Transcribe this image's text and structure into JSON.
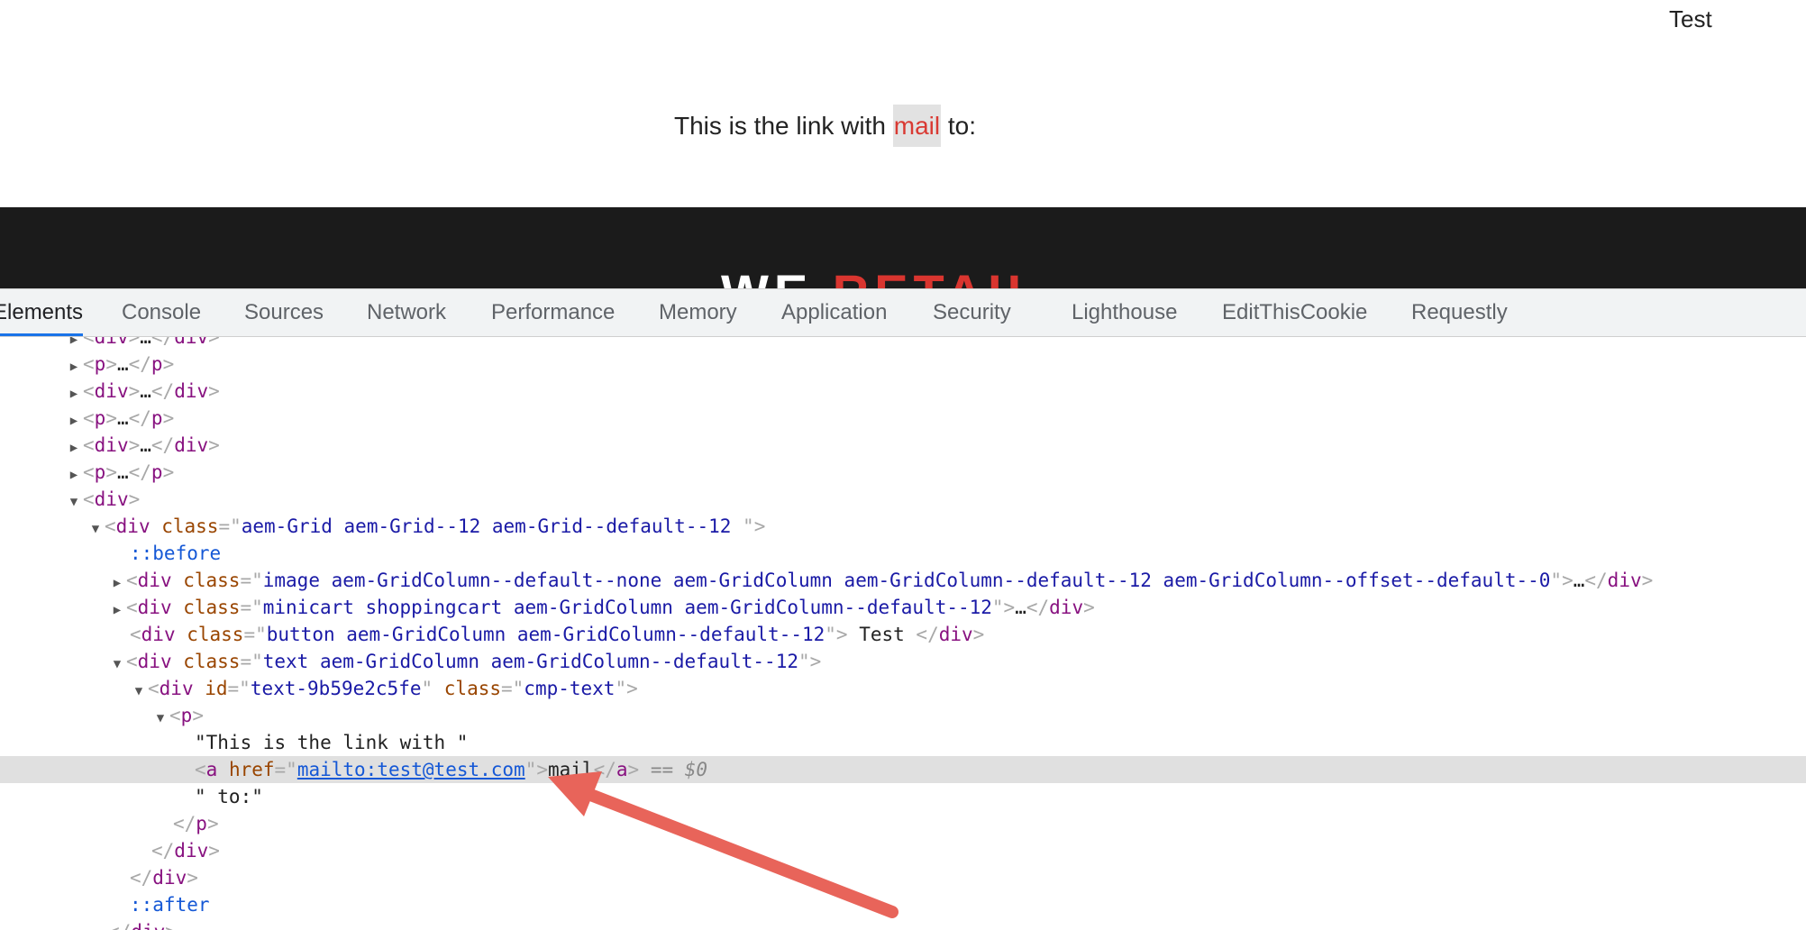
{
  "page": {
    "top_button_text": "Test",
    "paragraph_before": "This is the link with ",
    "paragraph_link": "mail",
    "paragraph_after": " to:",
    "footer_part1": "WE ",
    "footer_part2": "RETAIL"
  },
  "devtools": {
    "tabs": [
      "Elements",
      "Console",
      "Sources",
      "Network",
      "Performance",
      "Memory",
      "Application",
      "Security",
      "Lighthouse",
      "EditThisCookie",
      "Requestly"
    ],
    "active_tab": "Elements",
    "tree": {
      "r0": {
        "a": "div",
        "b": ">",
        "c": "…",
        "d": "</",
        "e": "div",
        "f": ">"
      },
      "r1": {
        "a": "<",
        "b": "p",
        "c": ">",
        "d": "…",
        "e": "</",
        "f": "p",
        "g": ">"
      },
      "r2": {
        "a": "<",
        "b": "div",
        "c": ">",
        "d": "…",
        "e": "</",
        "f": "div",
        "g": ">"
      },
      "r3": {
        "a": "<",
        "b": "p",
        "c": ">",
        "d": "…",
        "e": "</",
        "f": "p",
        "g": ">"
      },
      "r4": {
        "a": "<",
        "b": "div",
        "c": ">",
        "d": "…",
        "e": "</",
        "f": "div",
        "g": ">"
      },
      "r5": {
        "a": "<",
        "b": "p",
        "c": ">",
        "d": "…",
        "e": "</",
        "f": "p",
        "g": ">"
      },
      "r6": {
        "a": "<",
        "b": "div",
        "c": ">"
      },
      "r7": {
        "a": "<",
        "b": "div",
        "c": " class",
        "d": "=\"",
        "e": "aem-Grid aem-Grid--12 aem-Grid--default--12 ",
        "f": "\">"
      },
      "r8": {
        "a": "::before"
      },
      "r9": {
        "a": "<",
        "b": "div",
        "c": " class",
        "d": "=\"",
        "e": "image aem-GridColumn--default--none aem-GridColumn aem-GridColumn--default--12 aem-GridColumn--offset--default--0",
        "f": "\">",
        "g": "…",
        "h": "</",
        "i": "div",
        "j": ">"
      },
      "r10": {
        "a": "<",
        "b": "div",
        "c": " class",
        "d": "=\"",
        "e": "minicart shoppingcart aem-GridColumn aem-GridColumn--default--12",
        "f": "\">",
        "g": "…",
        "h": "</",
        "i": "div",
        "j": ">"
      },
      "r11": {
        "a": "<",
        "b": "div",
        "c": " class",
        "d": "=\"",
        "e": "button aem-GridColumn aem-GridColumn--default--12",
        "f": "\">",
        "g": " Test ",
        "h": "</",
        "i": "div",
        "j": ">"
      },
      "r12": {
        "a": "<",
        "b": "div",
        "c": " class",
        "d": "=\"",
        "e": "text aem-GridColumn aem-GridColumn--default--12",
        "f": "\">"
      },
      "r13": {
        "a": "<",
        "b": "div",
        "c": " id",
        "d": "=\"",
        "e": "text-9b59e2c5fe",
        "f": "\"",
        "g": " class",
        "h": "=\"",
        "i": "cmp-text",
        "j": "\">"
      },
      "r14": {
        "a": "<",
        "b": "p",
        "c": ">"
      },
      "r15": {
        "a": "\"This is the link with \""
      },
      "r16": {
        "a": "<",
        "b": "a",
        "c": " href",
        "d": "=\"",
        "e": "mailto:test@test.com",
        "f": "\">",
        "g": "mail",
        "h": "</",
        "i": "a",
        "j": ">",
        "k": " == ",
        "l": "$0"
      },
      "r17": {
        "a": "\" to:\""
      },
      "r18": {
        "a": "</",
        "b": "p",
        "c": ">"
      },
      "r19": {
        "a": "</",
        "b": "div",
        "c": ">"
      },
      "r20": {
        "a": "</",
        "b": "div",
        "c": ">"
      },
      "r21": {
        "a": "::after"
      },
      "r22": {
        "a": "</",
        "b": "div",
        "c": ">"
      }
    }
  },
  "colors": {
    "arrow": "#e8645a",
    "accent": "#1a73e8",
    "footer_red": "#d9352f"
  },
  "icons": {
    "collapsed": "triangle-right-icon",
    "expanded": "triangle-down-icon"
  }
}
